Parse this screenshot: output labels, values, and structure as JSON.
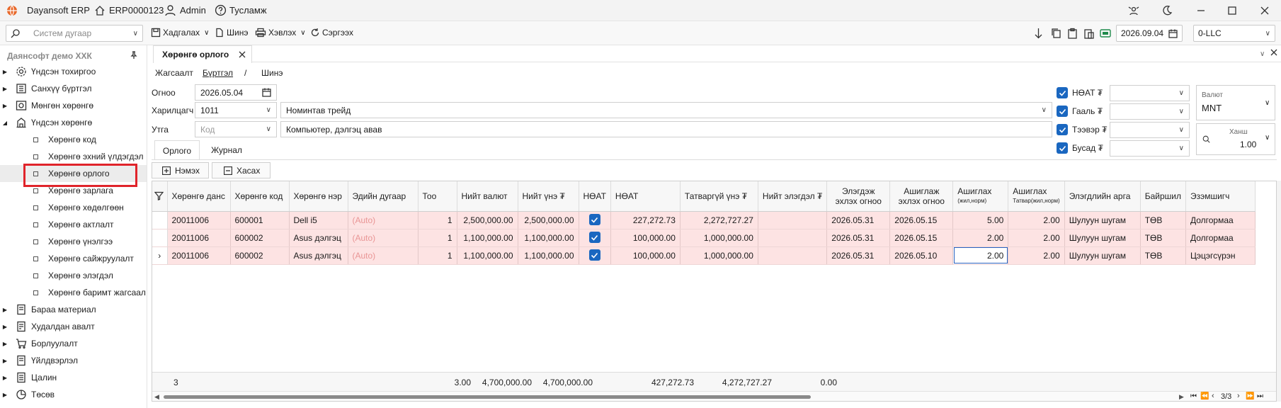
{
  "titlebar": {
    "app": "Dayansoft ERP",
    "code": "ERP0000123",
    "user": "Admin",
    "help": "Тусламж"
  },
  "toolbar": {
    "search_placeholder": "Систем дугаар",
    "manage": "Хадгалах",
    "new": "Шинэ",
    "print": "Хэвлэх",
    "refresh": "Сэргээх",
    "date": "2026.09.04",
    "company": "0-LLC"
  },
  "sidebar": {
    "company": "Даянсофт демо ХХК",
    "items": [
      {
        "label": "Үндсэн тохиргоо",
        "icon": "gear-icon"
      },
      {
        "label": "Санхүү бүртгэл",
        "icon": "ledger-icon"
      },
      {
        "label": "Мөнгөн хөрөнгө",
        "icon": "money-icon"
      },
      {
        "label": "Үндсэн хөрөнгө",
        "icon": "building-icon"
      }
    ],
    "subitems": [
      "Хөрөнгө код",
      "Хөрөнгө эхний үлдэгдэл",
      "Хөрөнгө орлого",
      "Хөрөнгө зарлага",
      "Хөрөнгө хөдөлгөөн",
      "Хөрөнгө актлалт",
      "Хөрөнгө үнэлгээ",
      "Хөрөнгө сайжруулалт",
      "Хөрөнгө элэгдэл",
      "Хөрөнгө баримт жагсаал"
    ],
    "bottom": [
      {
        "label": "Бараа материал",
        "icon": "box-icon"
      },
      {
        "label": "Худалдан авалт",
        "icon": "cart-icon"
      },
      {
        "label": "Борлуулалт",
        "icon": "sale-icon"
      },
      {
        "label": "Үйлдвэрлэл",
        "icon": "factory-icon"
      },
      {
        "label": "Цалин",
        "icon": "salary-icon"
      },
      {
        "label": "Төсөв",
        "icon": "pie-icon"
      }
    ]
  },
  "doc_tab": "Хөрөнгө орлого",
  "crumbs": {
    "list": "Жагсаалт",
    "register": "Бүртгэл",
    "sep": "/",
    "new": "Шинэ"
  },
  "form": {
    "date_label": "Огноо",
    "date": "2026.05.04",
    "partner_label": "Харилцагч",
    "partner_code": "1011",
    "partner_name": "Номинтав трейд",
    "desc_label": "Утга",
    "desc_code_placeholder": "Код",
    "desc": "Компьютер, дэлгэц авав",
    "vat": "НӨАТ ₮",
    "customs": "Гааль ₮",
    "transport": "Тээвэр ₮",
    "other": "Бусад ₮",
    "currency_label": "Валют",
    "currency": "MNT",
    "rate_label": "Ханш",
    "rate": "1.00"
  },
  "subtabs": [
    "Орлого",
    "Журнал"
  ],
  "grid_buttons": {
    "add": "Нэмэх",
    "remove": "Хасах"
  },
  "columns": [
    "Хөрөнгө данс",
    "Хөрөнгө код",
    "Хөрөнгө нэр",
    "Эдийн дугаар",
    "Тоо",
    "Нийт валют",
    "Нийт үнэ ₮",
    "НӨАТ",
    "НӨАТ",
    "Татваргүй үнэ ₮",
    "Нийт элэгдэл ₮",
    "Элэгдэж эхлэх огноо",
    "Ашиглаж эхлэх огноо",
    "Ашиглах",
    "(жил,норм)",
    "Ашиглах",
    "Татвар(жил,норм)",
    "Элэгдлийн арга",
    "Байршил",
    "Эзэмшигч"
  ],
  "rows": [
    {
      "account": "20011006",
      "code": "600001",
      "name": "Dell i5",
      "serial": "(Auto)",
      "qty": "1",
      "cur": "2,500,000.00",
      "total": "2,500,000.00",
      "vat": "227,272.73",
      "net": "2,272,727.27",
      "dep": "",
      "dep_start": "2026.05.31",
      "use_start": "2026.05.15",
      "life": "5.00",
      "tax_life": "2.00",
      "method": "Шулуун шугам",
      "loc": "ТӨВ",
      "owner": "Долгормаа"
    },
    {
      "account": "20011006",
      "code": "600002",
      "name": "Asus дэлгэц",
      "serial": "(Auto)",
      "qty": "1",
      "cur": "1,100,000.00",
      "total": "1,100,000.00",
      "vat": "100,000.00",
      "net": "1,000,000.00",
      "dep": "",
      "dep_start": "2026.05.31",
      "use_start": "2026.05.15",
      "life": "2.00",
      "tax_life": "2.00",
      "method": "Шулуун шугам",
      "loc": "ТӨВ",
      "owner": "Долгормаа"
    },
    {
      "account": "20011006",
      "code": "600002",
      "name": "Asus дэлгэц",
      "serial": "(Auto)",
      "qty": "1",
      "cur": "1,100,000.00",
      "total": "1,100,000.00",
      "vat": "100,000.00",
      "net": "1,000,000.00",
      "dep": "",
      "dep_start": "2026.05.31",
      "use_start": "2026.05.10",
      "life": "2.00",
      "tax_life": "2.00",
      "method": "Шулуун шугам",
      "loc": "ТӨВ",
      "owner": "Цэцэгсүрэн"
    }
  ],
  "footer": {
    "count": "3",
    "qty": "3.00",
    "cur": "4,700,000.00",
    "total": "4,700,000.00",
    "vat": "427,272.73",
    "net": "4,272,727.27",
    "dep": "0.00"
  },
  "pager": "3/3",
  "colors": {
    "row_bg": "#fde3e3",
    "check": "#1a67c0",
    "highlight": "#e0242b"
  }
}
